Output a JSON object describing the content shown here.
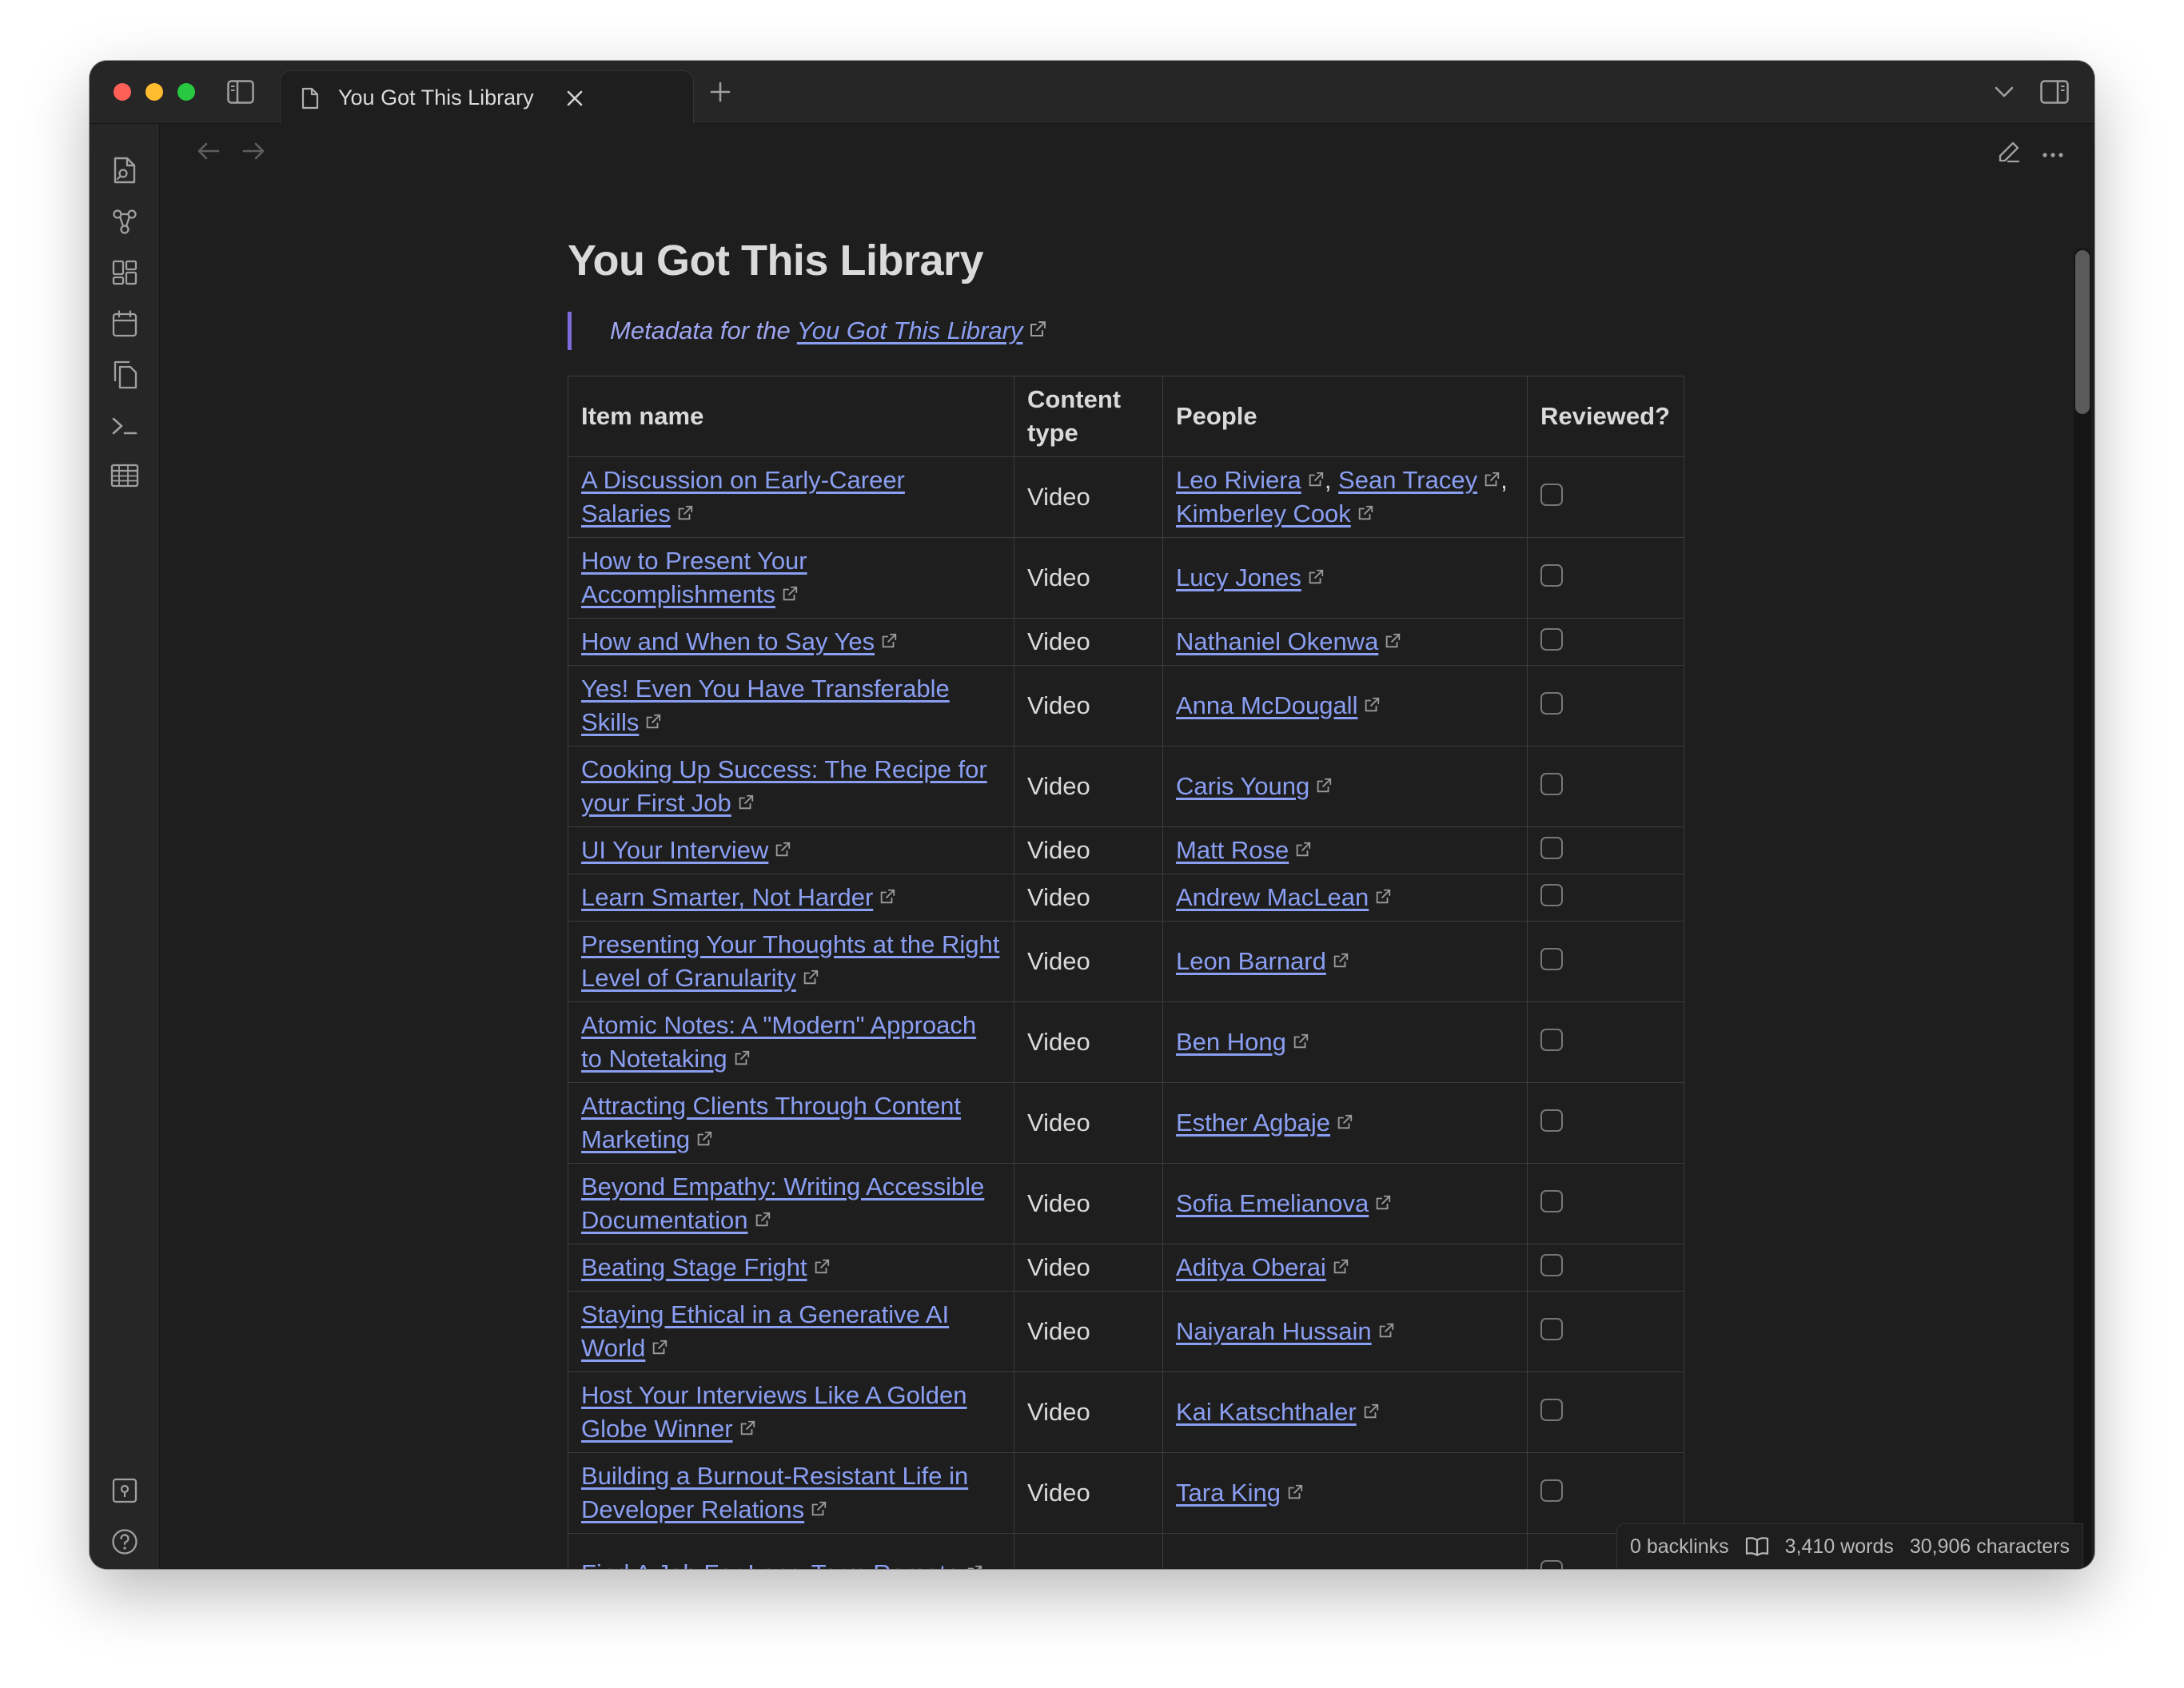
{
  "tab": {
    "title": "You Got This Library"
  },
  "page": {
    "title": "You Got This Library",
    "callout_prefix": "Metadata for the ",
    "callout_link": "You Got This Library"
  },
  "table": {
    "headers": [
      "Item name",
      "Content type",
      "People",
      "Reviewed?"
    ],
    "rows": [
      {
        "item": "A Discussion on Early-Career Salaries",
        "type": "Video",
        "people": [
          "Leo Riviera",
          "Sean Tracey",
          "Kimberley Cook"
        ],
        "reviewed": false
      },
      {
        "item": "How to Present Your Accomplishments",
        "type": "Video",
        "people": [
          "Lucy Jones"
        ],
        "reviewed": false
      },
      {
        "item": "How and When to Say Yes",
        "type": "Video",
        "people": [
          "Nathaniel Okenwa"
        ],
        "reviewed": false
      },
      {
        "item": "Yes! Even You Have Transferable Skills",
        "type": "Video",
        "people": [
          "Anna McDougall"
        ],
        "reviewed": false
      },
      {
        "item": "Cooking Up Success: The Recipe for your First Job",
        "type": "Video",
        "people": [
          "Caris Young"
        ],
        "reviewed": false
      },
      {
        "item": "UI Your Interview",
        "type": "Video",
        "people": [
          "Matt Rose"
        ],
        "reviewed": false
      },
      {
        "item": "Learn Smarter, Not Harder",
        "type": "Video",
        "people": [
          "Andrew MacLean"
        ],
        "reviewed": false
      },
      {
        "item": "Presenting Your Thoughts at the Right Level of Granularity",
        "type": "Video",
        "people": [
          "Leon Barnard"
        ],
        "reviewed": false
      },
      {
        "item": "Atomic Notes: A \"Modern\" Approach to Notetaking",
        "type": "Video",
        "people": [
          "Ben Hong"
        ],
        "reviewed": false
      },
      {
        "item": "Attracting Clients Through Content Marketing",
        "type": "Video",
        "people": [
          "Esther Agbaje"
        ],
        "reviewed": false
      },
      {
        "item": "Beyond Empathy: Writing Accessible Documentation",
        "type": "Video",
        "people": [
          "Sofia Emelianova"
        ],
        "reviewed": false
      },
      {
        "item": "Beating Stage Fright",
        "type": "Video",
        "people": [
          "Aditya Oberai"
        ],
        "reviewed": false
      },
      {
        "item": "Staying Ethical in a Generative AI World",
        "type": "Video",
        "people": [
          "Naiyarah Hussain"
        ],
        "reviewed": false
      },
      {
        "item": "Host Your Interviews Like A Golden Globe Winner",
        "type": "Video",
        "people": [
          "Kai Katschthaler"
        ],
        "reviewed": false
      },
      {
        "item": "Building a Burnout-Resistant Life in Developer Relations",
        "type": "Video",
        "people": [
          "Tara King"
        ],
        "reviewed": false
      },
      {
        "item": "Find A Job For Long-Term Remote",
        "type": "",
        "people": [],
        "reviewed": false
      }
    ]
  },
  "status": {
    "backlinks": "0 backlinks",
    "words": "3,410 words",
    "characters": "30,906 characters"
  },
  "icons": {
    "ribbon_top": [
      "quick-switcher-icon",
      "graph-view-icon",
      "canvas-icon",
      "daily-note-icon",
      "templates-icon",
      "command-palette-icon",
      "table-icon"
    ],
    "ribbon_bottom": [
      "vault-icon",
      "help-icon",
      "settings-icon"
    ]
  }
}
